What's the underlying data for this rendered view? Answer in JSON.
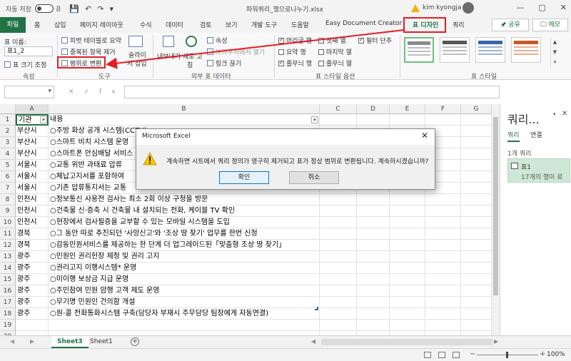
{
  "titlebar": {
    "autosave_label": "자동 저장",
    "autosave_state": "끔",
    "doc_title": "파워쿼리_행으로나누기.xlsx",
    "user": "kim kyongja",
    "qat": [
      "💾",
      "↶",
      "↷",
      "▾"
    ],
    "win_controls": [
      "—",
      "▢",
      "✕"
    ]
  },
  "ribbon_tabs": [
    "파일",
    "홈",
    "삽입",
    "페이지 레이아웃",
    "수식",
    "데이터",
    "검토",
    "보기",
    "개발 도구",
    "도움말",
    "Easy Document Creator",
    "표 디자인",
    "쿼리"
  ],
  "active_tab": "표 디자인",
  "share_label": "🖈 공유",
  "memo_label": "🖵 메모",
  "ribbon": {
    "properties": {
      "name_label": "표 이름:",
      "name_value": "표1_2",
      "resize": "표 크기 조정",
      "group": "속성"
    },
    "tools": {
      "items": [
        "피벗 테이블로 요약",
        "중복된 항목 제거",
        "범위로 변환"
      ],
      "slicer": [
        "슬라이",
        "서 삽입"
      ],
      "group": "도구"
    },
    "external": {
      "export": [
        "내보내기",
        "새로 고",
        "침"
      ],
      "items": [
        "속성",
        "브라우저에서 열기",
        "링크 끊기"
      ],
      "group": "외부 표 데이터"
    },
    "style_options": {
      "col1": [
        {
          "label": "머리글 행",
          "checked": true
        },
        {
          "label": "요약 행",
          "checked": false
        },
        {
          "label": "줄무늬 행",
          "checked": true
        }
      ],
      "col2": [
        {
          "label": "첫째 열",
          "checked": false
        },
        {
          "label": "마지막 열",
          "checked": false
        },
        {
          "label": "줄무늬 열",
          "checked": false
        }
      ],
      "col3": [
        {
          "label": "필터 단추",
          "checked": true
        }
      ],
      "group": "표 스타일 옵션"
    },
    "styles_group": "표 스타일"
  },
  "formula_bar": {
    "fx": "✕✓fx",
    "value": ""
  },
  "columns": [
    "A",
    "B",
    "C",
    "D",
    "E",
    "F",
    "G"
  ],
  "rows": [
    {
      "n": "1",
      "a": "기관",
      "b": "내용"
    },
    {
      "n": "2",
      "a": "부산시",
      "b": "○주방 화상 공개 시스템(CCTV)"
    },
    {
      "n": "3",
      "a": "부산시",
      "b": "○스마트 비치 시스템 운영"
    },
    {
      "n": "4",
      "a": "부산시",
      "b": "○스마트폰 안심배달 서비스"
    },
    {
      "n": "5",
      "a": "서울시",
      "b": "○교통 위반 과태료 압류"
    },
    {
      "n": "6",
      "a": "서울시",
      "b": "○체납고지서를 포함하여"
    },
    {
      "n": "7",
      "a": "서울시",
      "b": "○기존 압류통지서는 교통"
    },
    {
      "n": "8",
      "a": "인천시",
      "b": "○정보통신 사용전 검사는 최소 2회 이상 구청을 방문"
    },
    {
      "n": "9",
      "a": "인천시",
      "b": "○건축물 신·증축 시 건축물 내 설치되는 전화, 케이블 TV 확인"
    },
    {
      "n": "10",
      "a": "인천시",
      "b": "○현장에서 검사필증을 교부할 수 있는 모바일 시스템을 도입"
    },
    {
      "n": "11",
      "a": "경북",
      "b": "○그 동안 따로 추진되던 '사망신고'와 '조상 땅 찾기' 업무를 한번 신청"
    },
    {
      "n": "12",
      "a": "경북",
      "b": "○감동민원서비스를 제공하는 한 단계 더 업그레이드된「맞춤형 조상 땅 찾기」"
    },
    {
      "n": "13",
      "a": "광주",
      "b": "○민원인 권리헌장 제정 및 권리 고지"
    },
    {
      "n": "14",
      "a": "광주",
      "b": "○권리고지 이행시스템* 운영"
    },
    {
      "n": "15",
      "a": "광주",
      "b": "○미이행 보상금 지급 운영"
    },
    {
      "n": "16",
      "a": "광주",
      "b": "○주민참여 민원 암행 고객 제도 운영"
    },
    {
      "n": "17",
      "a": "광주",
      "b": "○무기명 민원인 건의함 개설"
    },
    {
      "n": "18",
      "a": "광주",
      "b": "○원-콜 전화통화시스템 구축(담당자 부재시 주무담당 팀장에게 자동연결)"
    },
    {
      "n": "19",
      "a": "",
      "b": ""
    },
    {
      "n": "20",
      "a": "",
      "b": ""
    }
  ],
  "queries_pane": {
    "title": "쿼리...",
    "tabs": [
      "쿼리",
      "연결"
    ],
    "count": "1개 쿼리",
    "item_name": "표1",
    "item_sub": "17개의 행이 로"
  },
  "sheets": [
    "Sheet3",
    "Sheet1"
  ],
  "active_sheet": "Sheet3",
  "status": {
    "minus": "−",
    "plus": "+",
    "zoom": "100%"
  },
  "dialog": {
    "title": "Microsoft Excel",
    "close": "✕",
    "message": "계속하면 시트에서 쿼리 정의가 영구히 제거되고 표가 정상 범위로 변환됩니다. 계속하시겠습니까?",
    "ok": "확인",
    "cancel": "취소"
  },
  "colors": {
    "accent": "#217346",
    "annotation": "#e51c23"
  }
}
